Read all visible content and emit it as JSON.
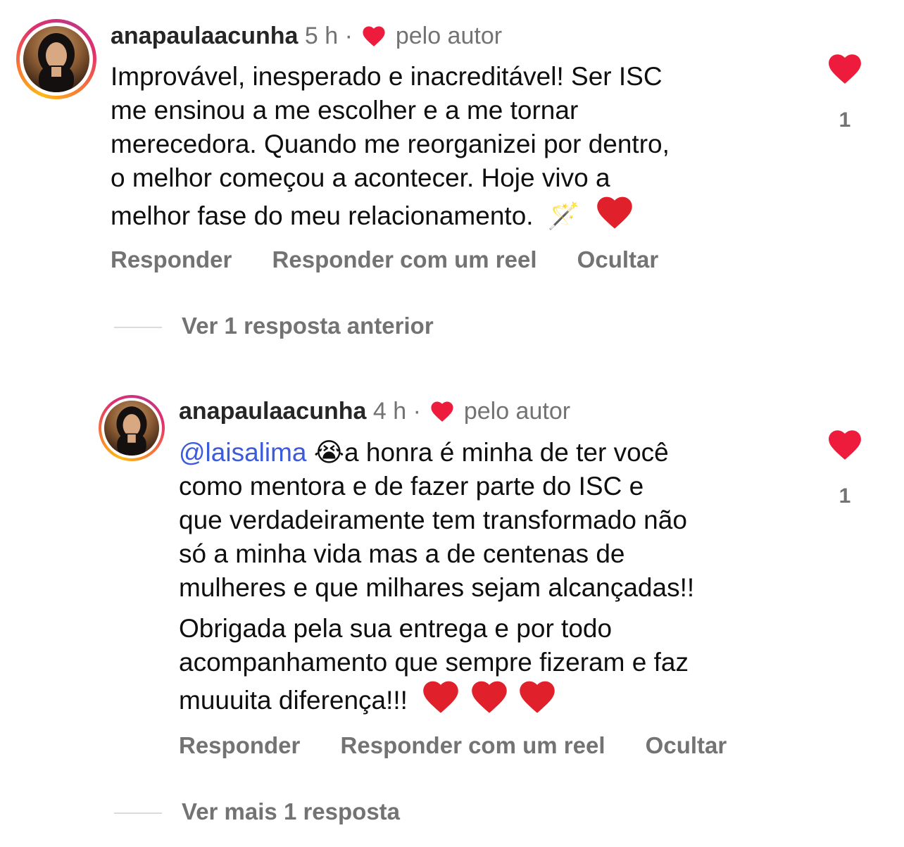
{
  "comments": [
    {
      "username": "anapaulaacunha",
      "time": "5 h",
      "separator": "·",
      "liked_by_author": "pelo autor",
      "text_lines": [
        "Improvável, inesperado e inacreditável! Ser ISC",
        "me ensinou a me escolher e a me tornar",
        "merecedora. Quando me reorganizei por dentro,",
        "o melhor começou a acontecer. Hoje vivo a",
        "melhor fase do meu relacionamento."
      ],
      "line_emoji": "🪄",
      "like_count": "1",
      "actions": {
        "reply": "Responder",
        "reply_reel": "Responder com um reel",
        "hide": "Ocultar"
      },
      "view_replies": "Ver 1 resposta anterior"
    },
    {
      "username": "anapaulaacunha",
      "time": "4 h",
      "separator": "·",
      "liked_by_author": "pelo autor",
      "mention": "@laisalima",
      "emoji_cry": "😭",
      "text_first": "a honra é minha de ter você",
      "text_lines": [
        "como mentora e de fazer parte do ISC e",
        "que verdadeiramente tem transformado não",
        "só a minha vida mas a de centenas de",
        "mulheres e que milhares sejam alcançadas!!"
      ],
      "text_lines_2": [
        "Obrigada pela sua entrega e por todo",
        "acompanhamento que sempre fizeram e faz",
        "muuuita diferença!!!"
      ],
      "like_count": "1",
      "actions": {
        "reply": "Responder",
        "reply_reel": "Responder com um reel",
        "hide": "Ocultar"
      },
      "view_replies": "Ver mais 1 resposta"
    }
  ],
  "colors": {
    "heart": "#ed1c3c",
    "meta": "#737373",
    "mention": "#3b5bdb"
  }
}
